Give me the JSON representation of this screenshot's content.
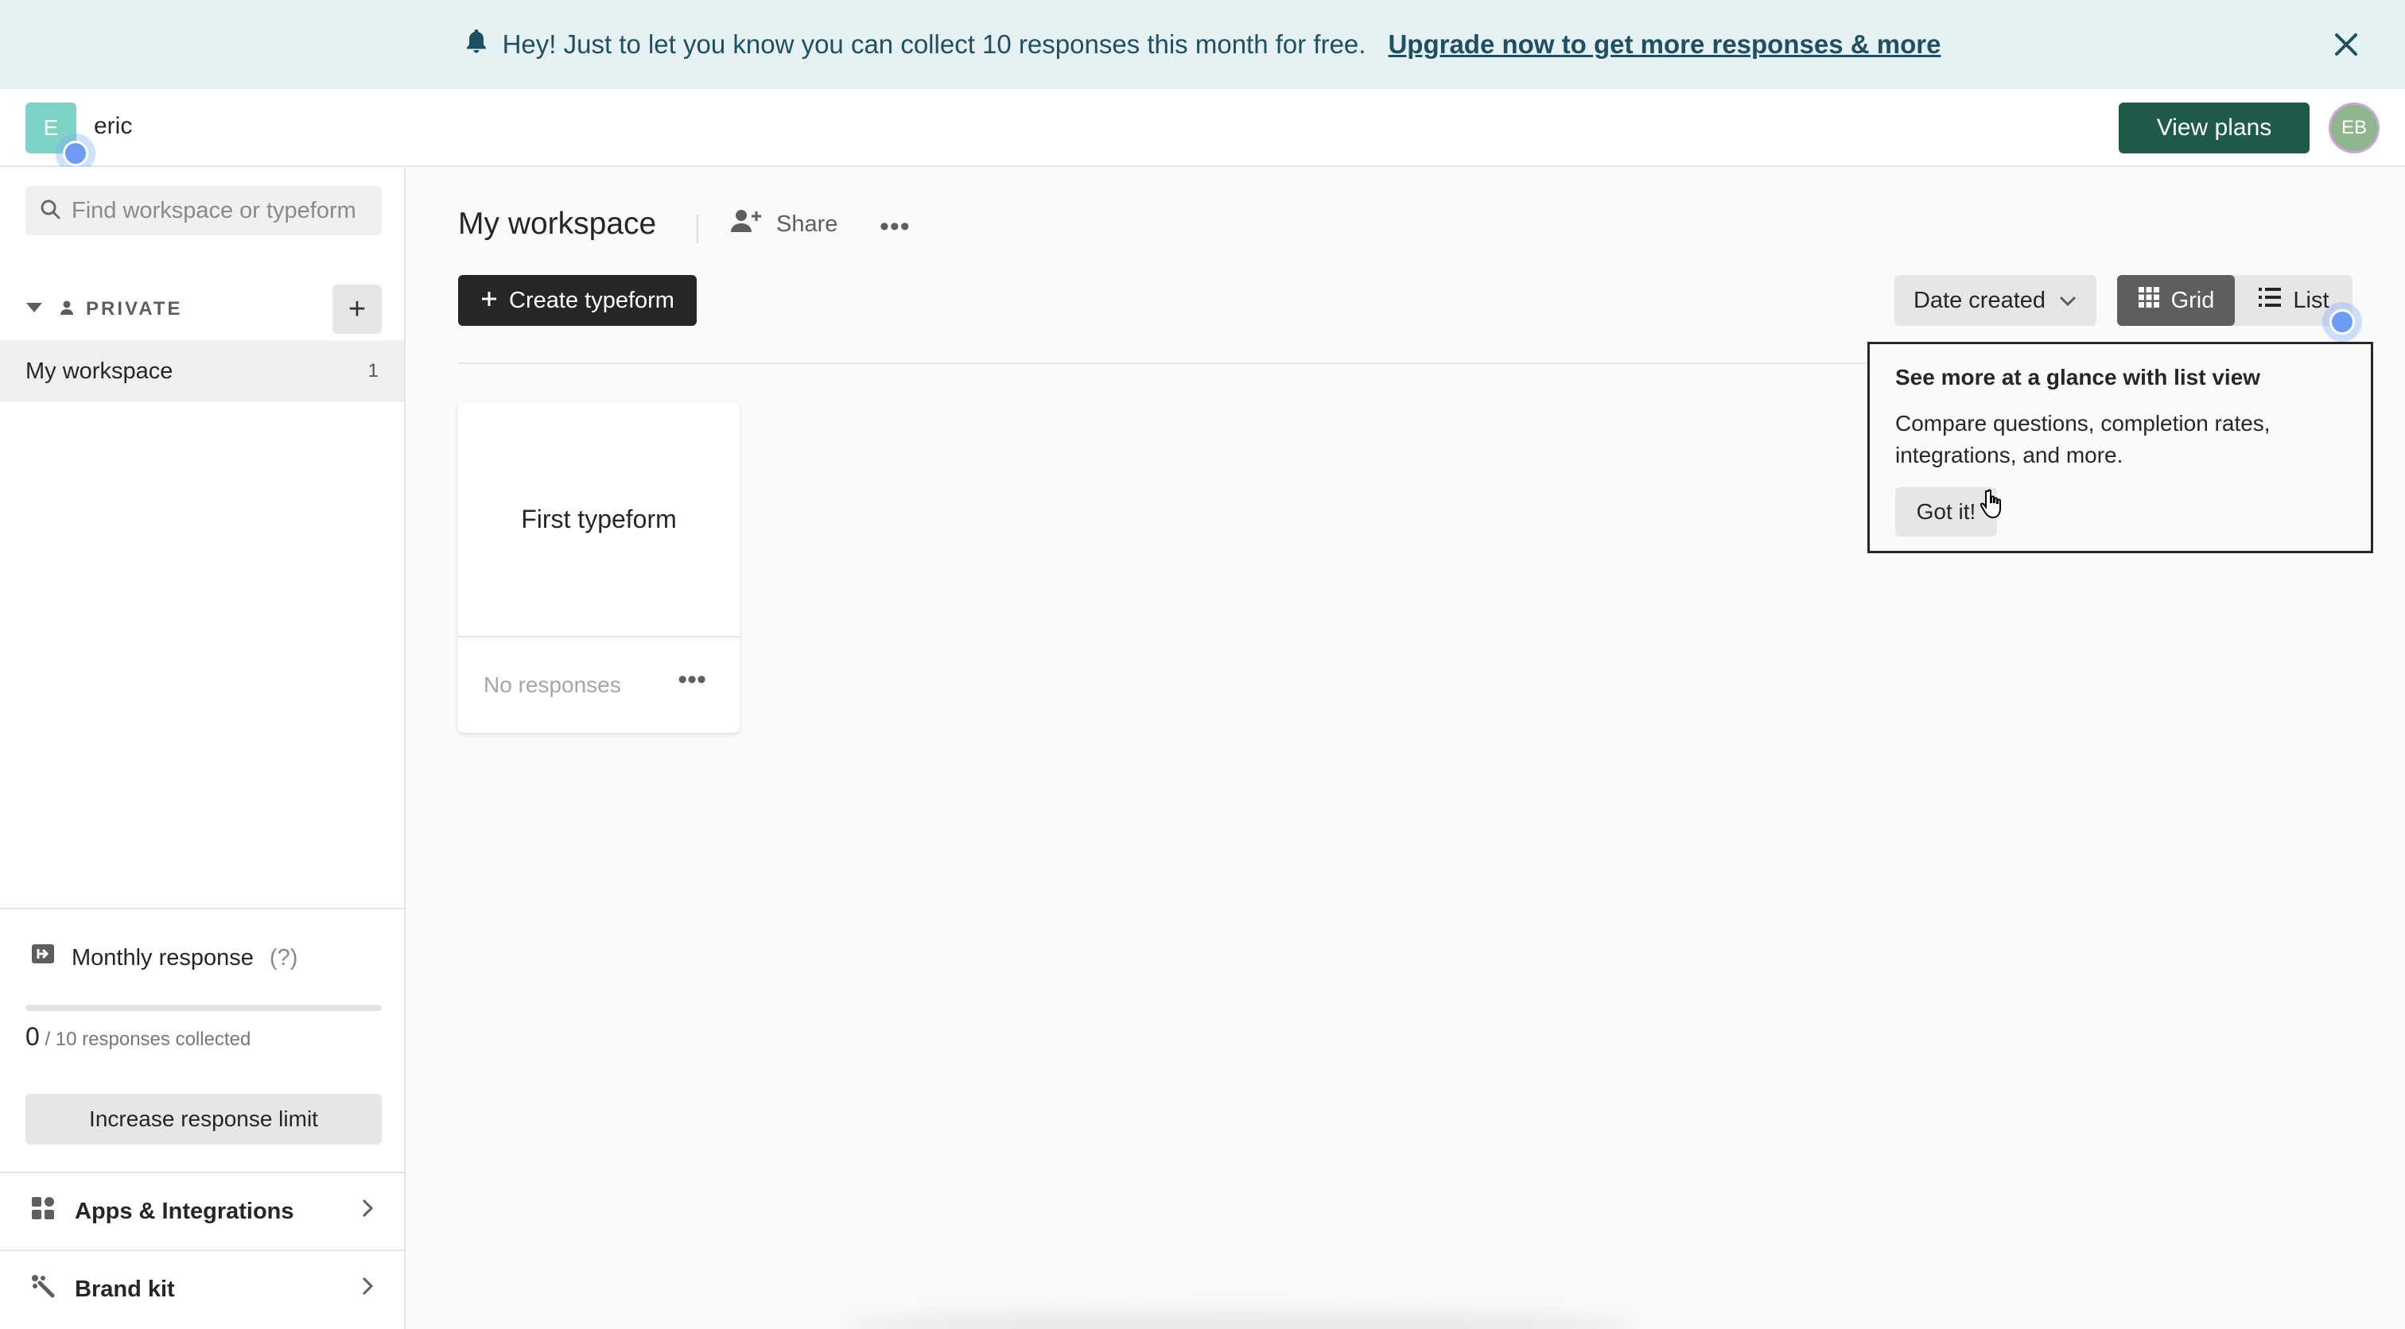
{
  "banner": {
    "message": "Hey! Just to let you know you can collect 10 responses this month for free.",
    "link_text": "Upgrade now to get more responses & more"
  },
  "topbar": {
    "workspace_initial": "E",
    "workspace_name": "eric",
    "view_plans_label": "View plans",
    "user_initials": "EB"
  },
  "sidebar": {
    "search_placeholder": "Find workspace or typeform",
    "private_label": "PRIVATE",
    "add_label": "+",
    "items": [
      {
        "label": "My workspace",
        "count": "1"
      }
    ],
    "monthly": {
      "label": "Monthly response",
      "help": "(?)",
      "collected_count": "0",
      "collected_suffix": "/ 10 responses collected",
      "progress": 0,
      "increase_label": "Increase response limit"
    },
    "links": [
      {
        "label": "Apps & Integrations"
      },
      {
        "label": "Brand kit"
      }
    ]
  },
  "main": {
    "title": "My workspace",
    "share_label": "Share",
    "create_label": "Create typeform",
    "sort_label": "Date created",
    "view_grid_label": "Grid",
    "view_list_label": "List",
    "forms": [
      {
        "title": "First typeform",
        "status": "No responses"
      }
    ]
  },
  "tooltip": {
    "title": "See more at a glance with list view",
    "body": "Compare questions, completion rates, integrations, and more.",
    "button": "Got it!"
  }
}
